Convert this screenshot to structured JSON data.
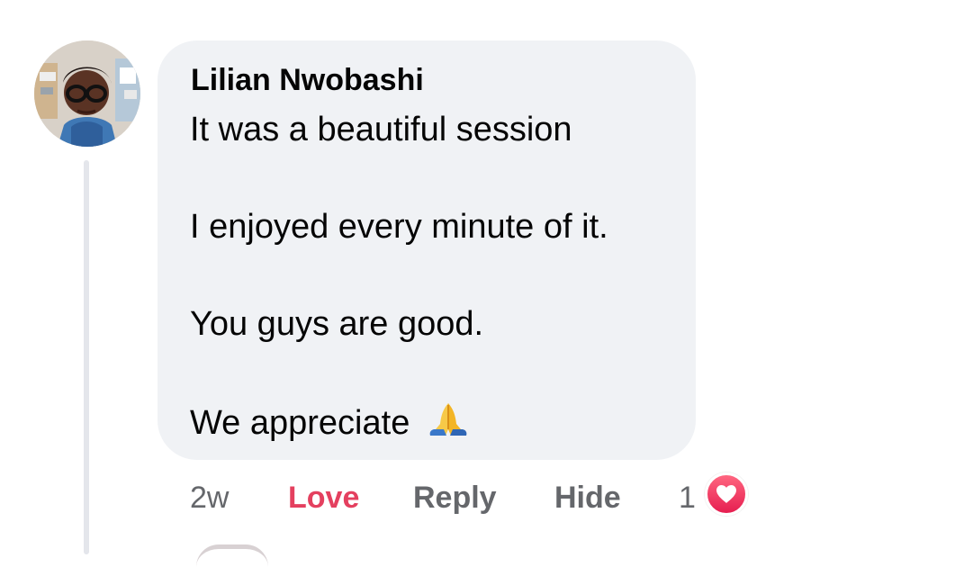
{
  "comment": {
    "author": "Lilian Nwobashi",
    "lines": [
      "It was a beautiful session",
      "I enjoyed every minute of it.",
      "You guys are good.",
      "We appreciate"
    ],
    "emoji": "praying-hands",
    "actions": {
      "time": "2w",
      "reaction": "Love",
      "reply": "Reply",
      "hide": "Hide"
    },
    "reaction_count": "1"
  },
  "colors": {
    "bubble": "#f0f2f5",
    "love": "#e4405f",
    "secondary_text": "#65676b",
    "thread_line": "#e4e6eb"
  },
  "icons": {
    "avatar": "user-photo-avatar",
    "emoji": "praying-hands-icon",
    "reaction_badge": "heart-icon"
  }
}
